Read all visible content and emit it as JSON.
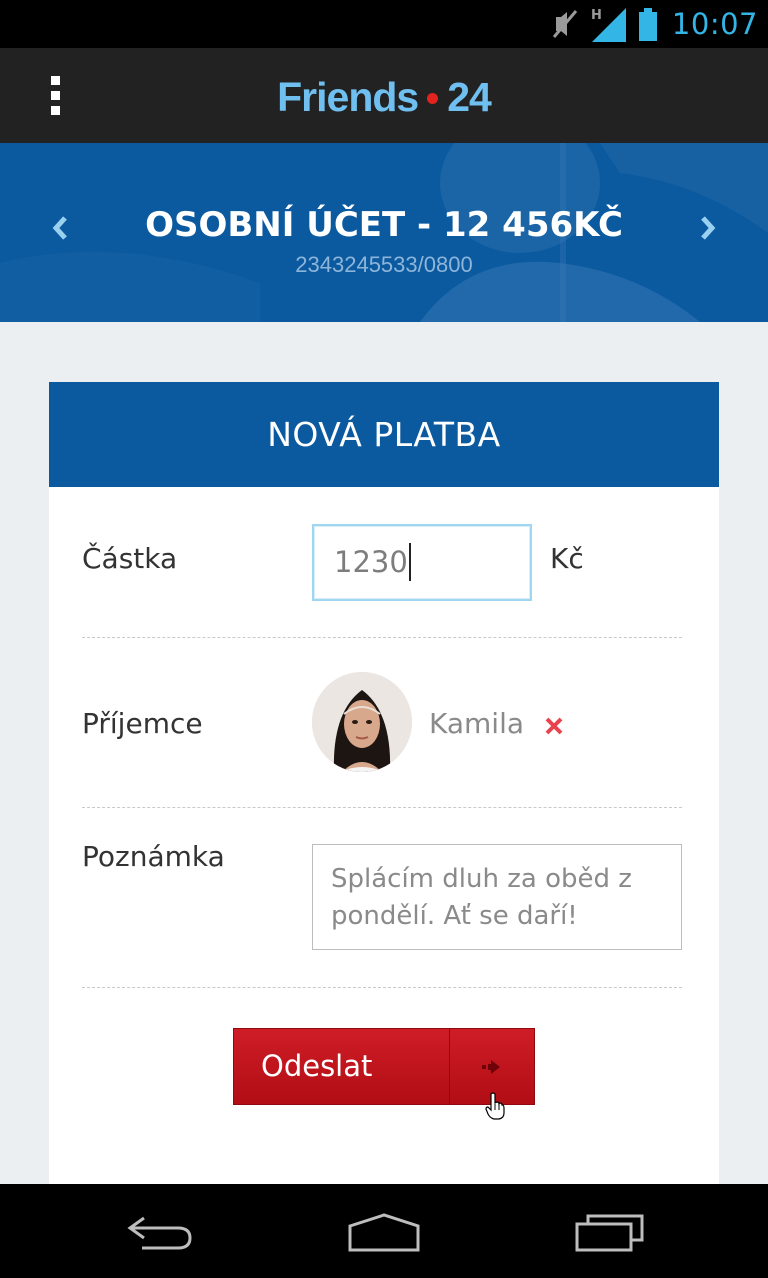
{
  "status_bar": {
    "time": "10:07",
    "network_type": "H",
    "icons": [
      "mute-icon",
      "signal-icon",
      "battery-icon"
    ],
    "accent_color": "#33b5e5"
  },
  "action_bar": {
    "logo_left": "Friends",
    "logo_right": "24",
    "menu_icon": "overflow-menu-icon"
  },
  "account": {
    "title": "OSOBNÍ ÚČET - 12 456KČ",
    "number": "2343245533/0800",
    "prev_icon": "chevron-left-icon",
    "next_icon": "chevron-right-icon"
  },
  "payment_form": {
    "header": "NOVÁ PLATBA",
    "amount_label": "Částka",
    "amount_value": "1230",
    "currency": "Kč",
    "recipient_label": "Příjemce",
    "recipient_name": "Kamila",
    "note_label": "Poznámka",
    "note_value": "Splácím dluh za oběd z pondělí. Ať se daří!",
    "submit_label": "Odeslat"
  },
  "nav_bar": {
    "buttons": [
      "back-icon",
      "home-icon",
      "recent-apps-icon"
    ]
  },
  "colors": {
    "brand_blue": "#0b5aa0",
    "logo_blue": "#6fc0f0",
    "accent_red": "#e3231f",
    "button_red": "#c4151e"
  }
}
